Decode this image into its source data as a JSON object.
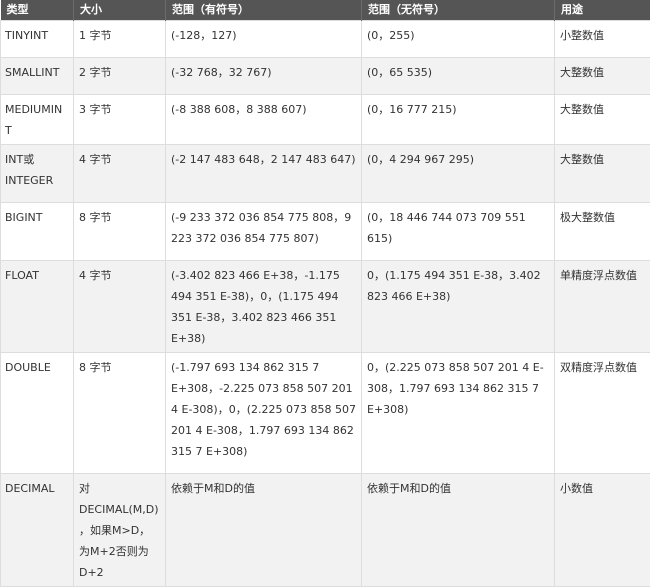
{
  "table": {
    "headers": [
      "类型",
      "大小",
      "范围（有符号）",
      "范围（无符号）",
      "用途"
    ],
    "rows": [
      [
        "TINYINT",
        "1 字节",
        "(-128，127)",
        "(0，255)",
        "小整数值"
      ],
      [
        "SMALLINT",
        "2 字节",
        "(-32 768，32 767)",
        "(0，65 535)",
        "大整数值"
      ],
      [
        "MEDIUMINT",
        "3 字节",
        "(-8 388 608，8 388 607)",
        "(0，16 777 215)",
        "大整数值"
      ],
      [
        "INT或INTEGER",
        "4 字节",
        "(-2 147 483 648，2 147 483 647)",
        "(0，4 294 967 295)",
        "大整数值"
      ],
      [
        "BIGINT",
        "8 字节",
        "(-9 233 372 036 854 775 808，9 223 372 036 854 775 807)",
        "(0，18 446 744 073 709 551 615)",
        "极大整数值"
      ],
      [
        "FLOAT",
        "4 字节",
        "(-3.402 823 466 E+38，-1.175 494 351 E-38)，0，(1.175 494 351 E-38，3.402 823 466 351 E+38)",
        "0，(1.175 494 351 E-38，3.402 823 466 E+38)",
        "单精度浮点数值"
      ],
      [
        "DOUBLE",
        "8 字节",
        "(-1.797 693 134 862 315 7 E+308，-2.225 073 858 507 201 4 E-308)，0，(2.225 073 858 507 201 4 E-308，1.797 693 134 862 315 7 E+308)",
        "0，(2.225 073 858 507 201 4 E-308，1.797 693 134 862 315 7 E+308)",
        "双精度浮点数值"
      ],
      [
        "DECIMAL",
        "对DECIMAL(M,D)，如果M>D，为M+2否则为D+2",
        "依赖于M和D的值",
        "依赖于M和D的值",
        "小数值"
      ]
    ]
  }
}
